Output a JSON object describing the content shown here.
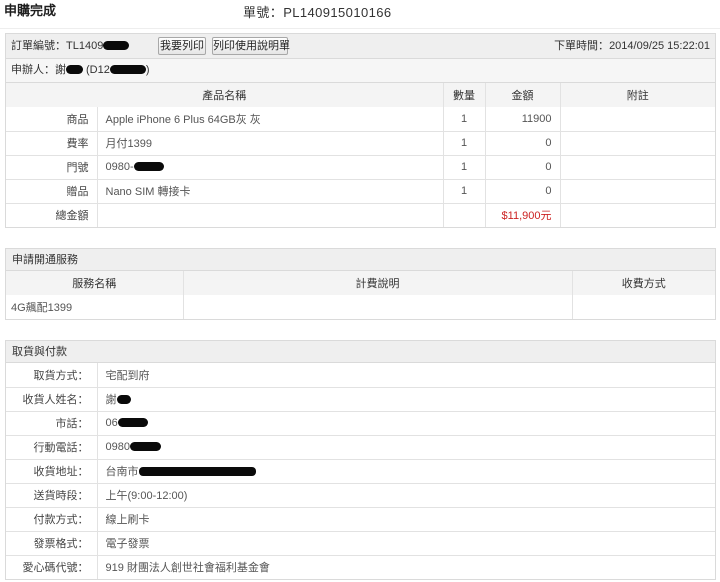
{
  "header": {
    "title": "申購完成",
    "order_no_label": "單號：",
    "order_no": "PL140915010166"
  },
  "order": {
    "id_label": "訂單編號：",
    "id_prefix": "TL1409",
    "buttons": {
      "print": "我要列印",
      "print_guide": "列印使用說明單"
    },
    "time_label": "下單時間：",
    "time": "2014/09/25 15:22:01",
    "applicant_label": "申辦人：",
    "applicant_name_prefix": "謝",
    "applicant_id_prefix": "(D12",
    "applicant_id_suffix": ")",
    "columns": {
      "product_name": "產品名稱",
      "quantity": "數量",
      "amount": "金額",
      "note": "附註"
    },
    "items": [
      {
        "category": "商品",
        "name": "Apple iPhone 6 Plus 64GB灰 灰",
        "quantity": "1",
        "amount": "11900"
      },
      {
        "category": "費率",
        "name": "月付1399",
        "quantity": "1",
        "amount": "0"
      },
      {
        "category": "門號",
        "name": "0980-",
        "quantity": "1",
        "amount": "0"
      },
      {
        "category": "贈品",
        "name": "Nano SIM 轉接卡",
        "quantity": "1",
        "amount": "0"
      }
    ],
    "total_label": "總金額",
    "total": "$11,900元"
  },
  "services": {
    "title": "申請開通服務",
    "columns": {
      "name": "服務名稱",
      "billing": "計費說明",
      "payment": "收費方式"
    },
    "rows": [
      {
        "name": "4G飆配1399"
      }
    ]
  },
  "delivery": {
    "title": "取貨與付款",
    "fields": [
      {
        "label": "取貨方式：",
        "value": "宅配到府"
      },
      {
        "label": "收貨人姓名：",
        "value": "謝"
      },
      {
        "label": "市話：",
        "value": "06"
      },
      {
        "label": "行動電話：",
        "value": "0980"
      },
      {
        "label": "收貨地址：",
        "value": "台南市"
      },
      {
        "label": "送貨時段：",
        "value": "上午(9:00-12:00)"
      },
      {
        "label": "付款方式：",
        "value": "線上刷卡"
      },
      {
        "label": "發票格式：",
        "value": "電子發票"
      },
      {
        "label": "愛心碼代號：",
        "value": "919 財團法人創世社會福利基金會"
      }
    ]
  },
  "colors": {
    "total_amount": "#cc2222",
    "panel_header_bg": "#efefef",
    "border": "#dadada"
  }
}
